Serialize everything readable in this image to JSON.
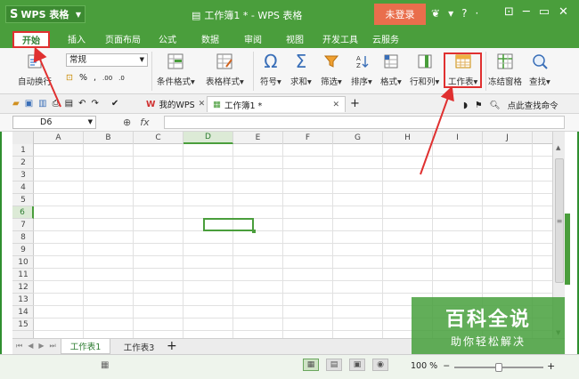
{
  "app": {
    "name": "WPS 表格",
    "logo": "S",
    "doc_title": "工作簿1 * - WPS 表格",
    "login": "未登录"
  },
  "titlebar_icons": [
    "shirt-icon",
    "help-icon"
  ],
  "menu": [
    "开始",
    "插入",
    "页面布局",
    "公式",
    "数据",
    "审阅",
    "视图",
    "开发工具",
    "云服务"
  ],
  "ribbon": {
    "paste_label": "自动换行",
    "number_format": "常规",
    "num_buttons": [
      "%",
      "‰",
      ".00",
      ".0"
    ],
    "buttons": [
      "条件格式",
      "表格样式",
      "符号",
      "求和",
      "筛选",
      "排序",
      "格式",
      "行和列",
      "工作表",
      "冻结窗格",
      "查找"
    ]
  },
  "tabs": {
    "mywps": "我的WPS",
    "doc": "工作簿1 *",
    "search": "点此查找命令"
  },
  "formula": {
    "cell_ref": "D6",
    "fx": "fx"
  },
  "grid": {
    "columns": [
      "A",
      "B",
      "C",
      "D",
      "E",
      "F",
      "G",
      "H",
      "I",
      "J"
    ],
    "rows": [
      "1",
      "2",
      "3",
      "4",
      "5",
      "6",
      "7",
      "8",
      "9",
      "10",
      "11",
      "12",
      "13",
      "14",
      "15"
    ],
    "selected_col": "D",
    "selected_row": "6"
  },
  "sheets": {
    "active": "工作表1",
    "other": "工作表3"
  },
  "status": {
    "zoom": "100 %"
  },
  "watermark": {
    "big": "百科全说",
    "small": "助你轻松解决"
  },
  "colors": {
    "accent": "#4a9e3c",
    "highlight": "#e03030",
    "login": "#e96e4c"
  }
}
